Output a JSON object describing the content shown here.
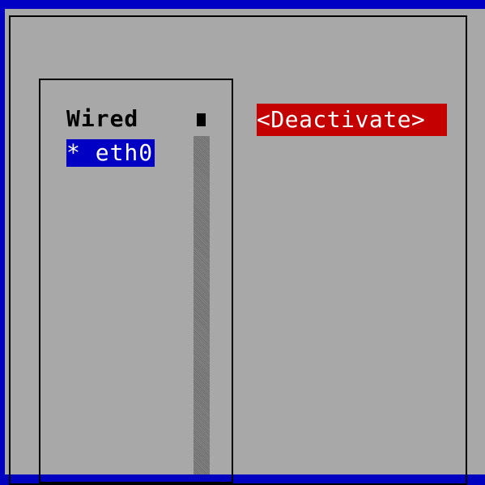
{
  "list": {
    "header": "Wired",
    "items": [
      {
        "label": "* eth0"
      }
    ]
  },
  "actions": {
    "deactivate_label": "<Deactivate>"
  },
  "colors": {
    "background_blue": "#0000c4",
    "dialog_gray": "#a8a8a8",
    "selection_blue": "#0000c4",
    "button_red": "#c40000"
  }
}
